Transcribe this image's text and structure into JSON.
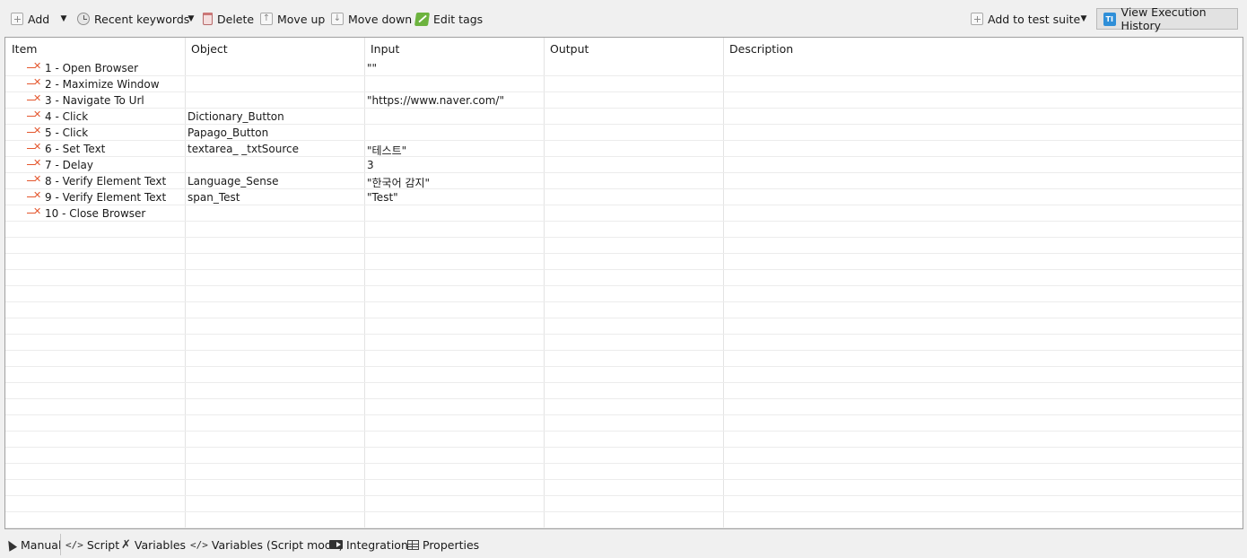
{
  "toolbar": {
    "add_label": "Add",
    "recent_label": "Recent keywords",
    "delete_label": "Delete",
    "move_up_label": "Move up",
    "move_down_label": "Move down",
    "edit_tags_label": "Edit tags",
    "add_to_suite_label": "Add to test suite",
    "view_history_label": "View Execution History"
  },
  "table": {
    "columns": [
      "Item",
      "Object",
      "Input",
      "Output",
      "Description"
    ],
    "rows": [
      {
        "item": "1 - Open Browser",
        "object": "",
        "input": "\"\"",
        "output": "",
        "description": ""
      },
      {
        "item": "2 - Maximize Window",
        "object": "",
        "input": "",
        "output": "",
        "description": ""
      },
      {
        "item": "3 - Navigate To Url",
        "object": "",
        "input": "\"https://www.naver.com/\"",
        "output": "",
        "description": ""
      },
      {
        "item": "4 - Click",
        "object": "Dictionary_Button",
        "input": "",
        "output": "",
        "description": ""
      },
      {
        "item": "5 - Click",
        "object": "Papago_Button",
        "input": "",
        "output": "",
        "description": ""
      },
      {
        "item": "6 - Set Text",
        "object": "textarea_ _txtSource",
        "input": "\"테스트\"",
        "output": "",
        "description": ""
      },
      {
        "item": "7 - Delay",
        "object": "",
        "input": "3",
        "output": "",
        "description": ""
      },
      {
        "item": "8 - Verify Element Text",
        "object": "Language_Sense",
        "input": "\"한국어 감지\"",
        "output": "",
        "description": ""
      },
      {
        "item": "9 - Verify Element Text",
        "object": "span_Test",
        "input": "\"Test\"",
        "output": "",
        "description": ""
      },
      {
        "item": "10 - Close Browser",
        "object": "",
        "input": "",
        "output": "",
        "description": ""
      }
    ]
  },
  "tabs": [
    {
      "label": "Manual",
      "icon": "cursor-icon"
    },
    {
      "label": "Script",
      "icon": "code-icon"
    },
    {
      "label": "Variables",
      "icon": "variable-icon"
    },
    {
      "label": "Variables (Script mode)",
      "icon": "code-icon"
    },
    {
      "label": "Integration",
      "icon": "integration-icon"
    },
    {
      "label": "Properties",
      "icon": "table-icon"
    }
  ],
  "colors": {
    "step_icon": "#e4572e",
    "accent": "#2f8fd8"
  }
}
